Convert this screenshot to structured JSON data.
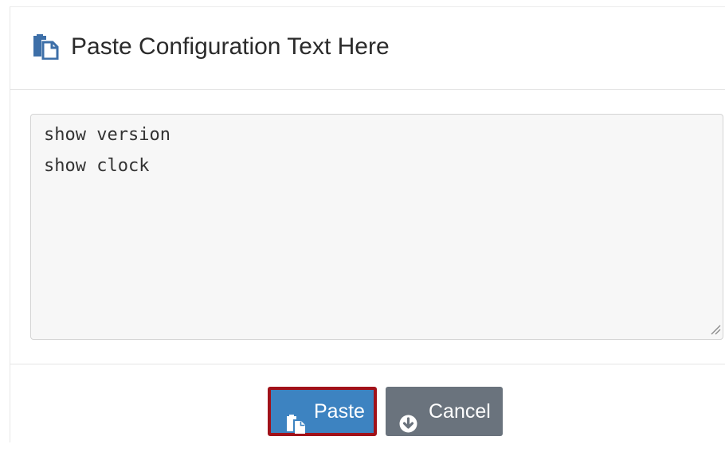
{
  "dialog": {
    "title": "Paste Configuration Text Here",
    "title_icon": "paste-icon"
  },
  "editor": {
    "value": "show version\nshow clock",
    "resize_icon": "resize-grip-icon"
  },
  "footer": {
    "paste_label": "Paste",
    "paste_icon": "paste-icon",
    "cancel_label": "Cancel",
    "cancel_icon": "circle-arrow-down-icon"
  },
  "colors": {
    "primary": "#3d83c1",
    "primary_highlight_border": "#a1121a",
    "secondary": "#6a737d",
    "title_text": "#2b2b2b"
  }
}
